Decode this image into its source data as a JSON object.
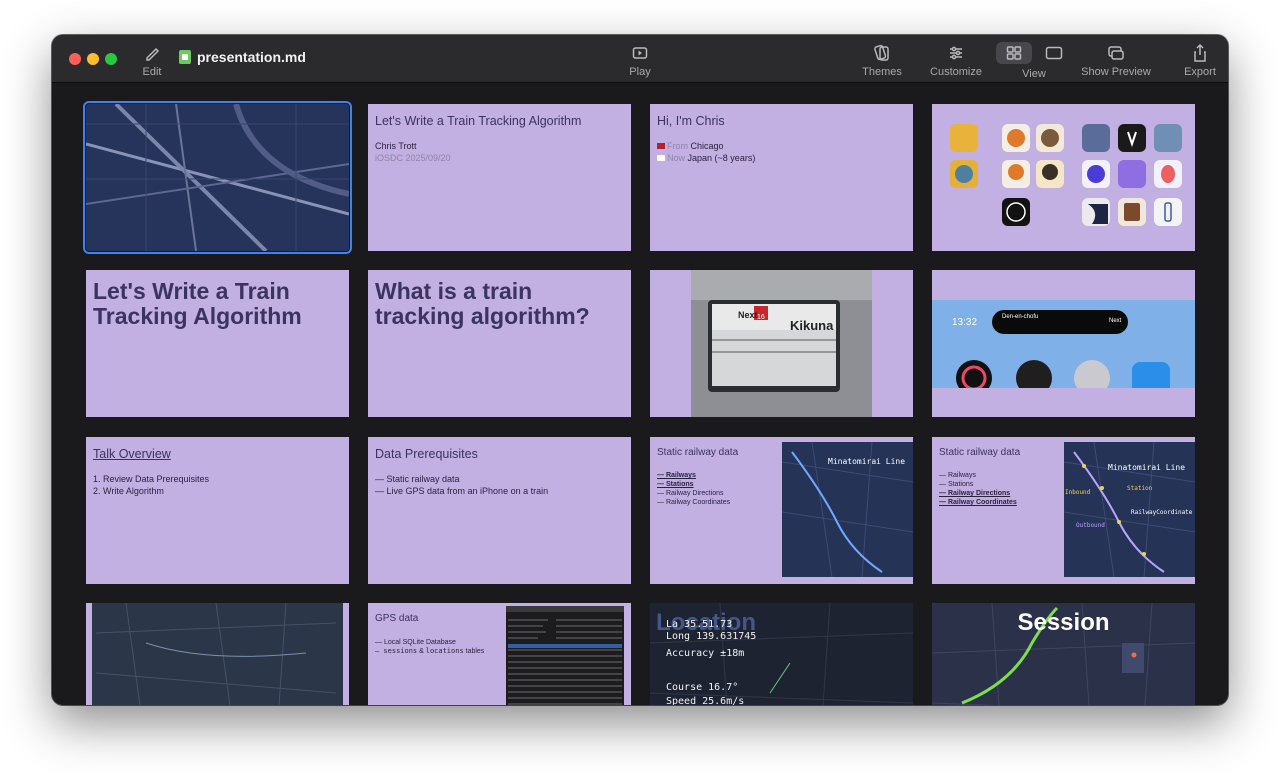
{
  "window": {
    "file_name": "presentation.md"
  },
  "toolbar": {
    "edit_label": "Edit",
    "play_label": "Play",
    "themes_label": "Themes",
    "customize_label": "Customize",
    "view_label": "View",
    "show_preview_label": "Show Preview",
    "export_label": "Export"
  },
  "slides": {
    "s2": {
      "title": "Let's Write a Train Tracking Algorithm",
      "author": "Chris Trott",
      "event": "iOSDC 2025/09/20"
    },
    "s3": {
      "title": "Hi, I'm Chris",
      "from_label": "From",
      "from_value": "Chicago",
      "now_label": "Now",
      "now_value": "Japan (~8 years)"
    },
    "s5": {
      "title": "Let's Write a Train Tracking Algorithm"
    },
    "s6": {
      "title": "What is a train tracking algorithm?"
    },
    "s7": {
      "next_label": "Next",
      "station": "Kikuna",
      "line_no": "16"
    },
    "s8": {
      "time": "13:32",
      "station": "Den-en-chofu",
      "next": "Next"
    },
    "s9": {
      "title": "Talk Overview",
      "items": [
        "1. Review Data Prerequisites",
        "2. Write Algorithm"
      ]
    },
    "s10": {
      "title": "Data Prerequisites",
      "items": [
        "— Static railway data",
        "— Live GPS data from an iPhone on a train"
      ]
    },
    "s11": {
      "title": "Static railway data",
      "items": [
        "— Railways",
        "— Stations",
        "— Railway Directions",
        "— Railway Coordinates"
      ],
      "map_label": "Minatomirai Line"
    },
    "s12": {
      "title": "Static railway data",
      "items": [
        "— Railways",
        "— Stations",
        "— Railway Directions",
        "— Railway Coordinates"
      ],
      "map_label": "Minatomirai Line",
      "station_label": "Station",
      "inbound_label": "Inbound",
      "outbound_label": "Outbound",
      "railway_coord_label": "RailwayCoordinate"
    },
    "s14": {
      "title": "GPS data",
      "line1": "— Local SQLite Database",
      "line2_a": "— sessions",
      "line2_b": "&",
      "line2_c": "locations",
      "line2_d": "tables"
    },
    "s15": {
      "overlay": "Location",
      "lat": "La    35.51.73",
      "long": "Long 139.631745",
      "accuracy": "Accuracy ±18m",
      "course": "Course 16.7°",
      "speed": "Speed 25.6m/s"
    },
    "s16": {
      "title": "Session"
    }
  },
  "colors": {
    "slide_bg": "#c1b0e1",
    "slide_text": "#3b3360",
    "selection": "#3b82f6",
    "toolbar_bg": "#2b2b2e"
  }
}
